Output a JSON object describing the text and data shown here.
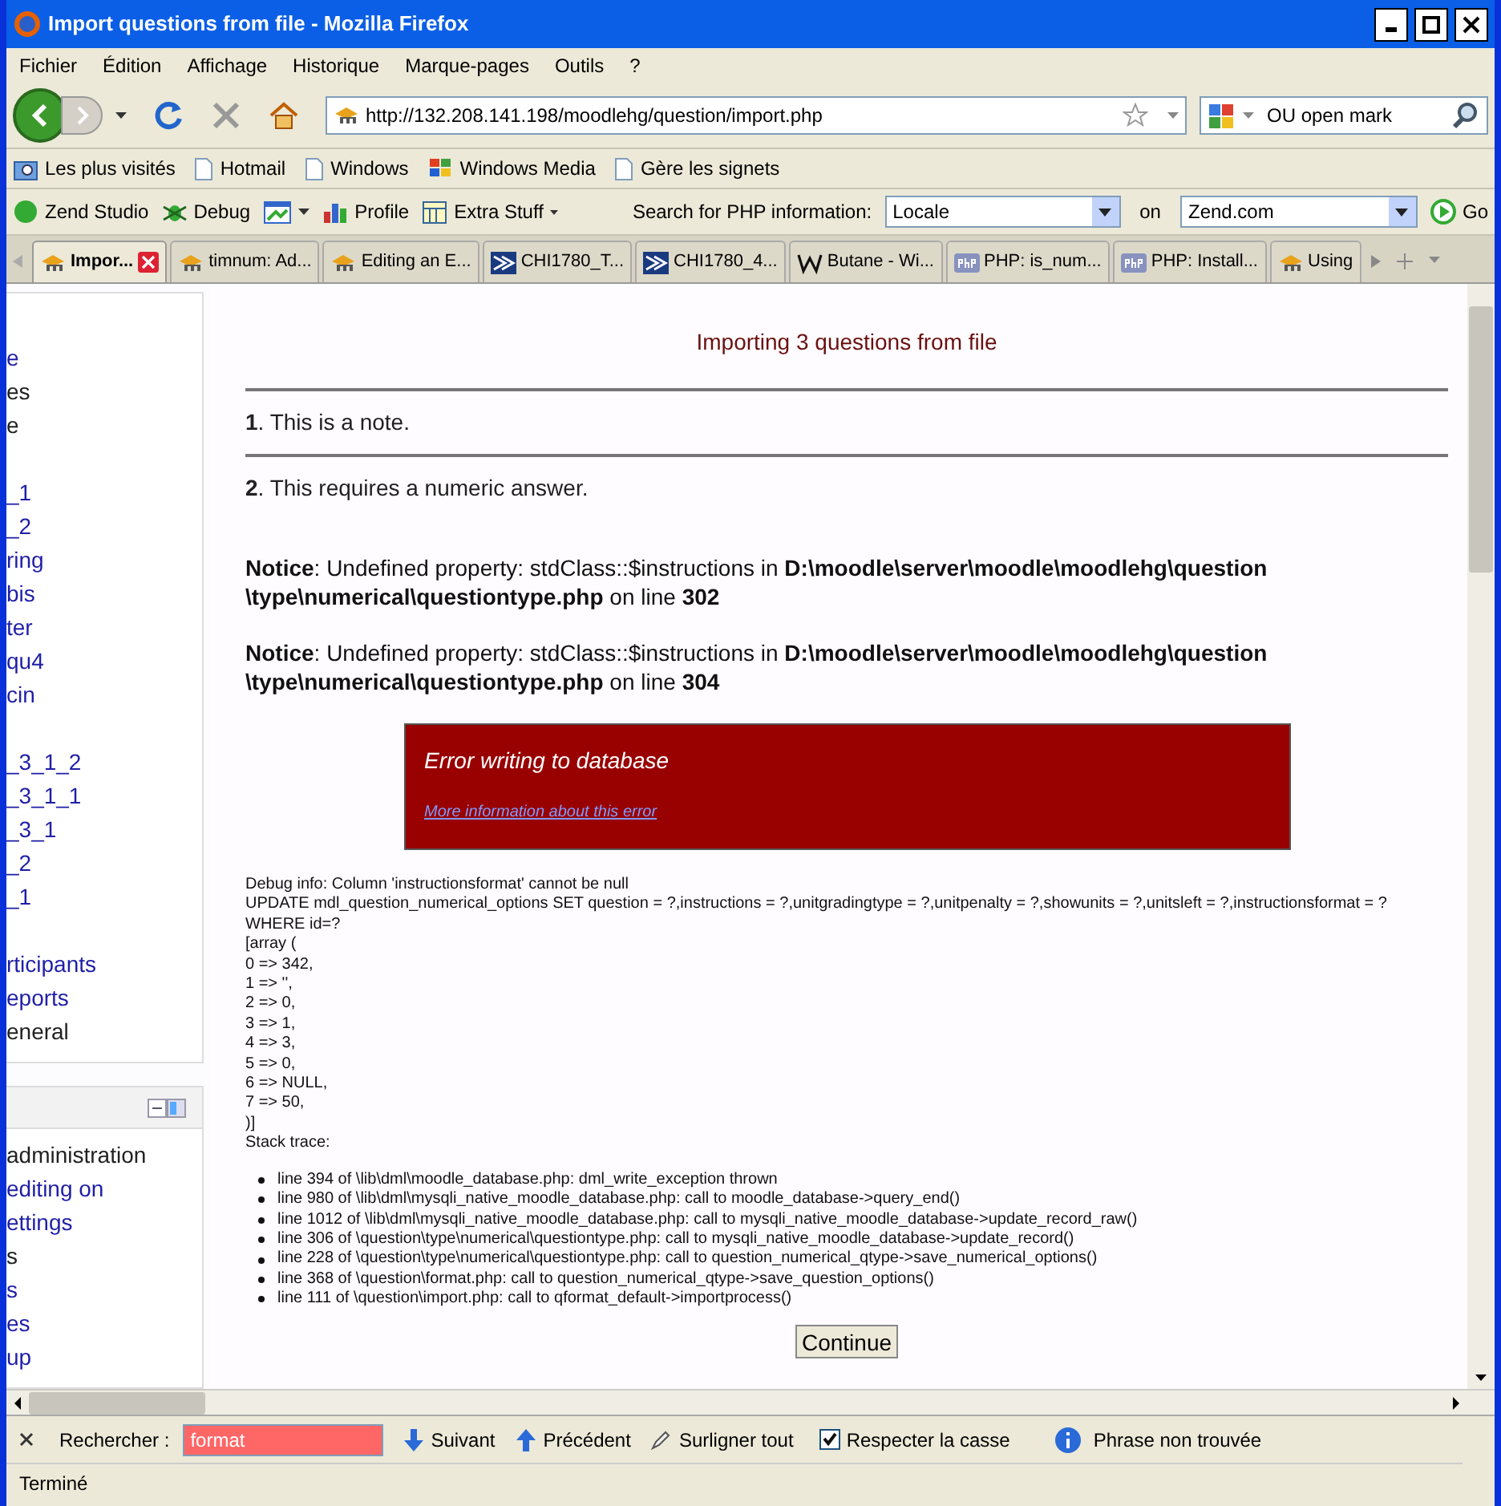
{
  "window": {
    "title": "Import questions from file - Mozilla Firefox"
  },
  "menu": [
    "Fichier",
    "Édition",
    "Affichage",
    "Historique",
    "Marque-pages",
    "Outils",
    "?"
  ],
  "nav": {
    "url": "http://132.208.141.198/moodlehg/question/import.php",
    "search": "OU open mark"
  },
  "bookmarks": [
    {
      "label": "Les plus visités",
      "kind": "folder"
    },
    {
      "label": "Hotmail",
      "kind": "page"
    },
    {
      "label": "Windows",
      "kind": "page"
    },
    {
      "label": "Windows Media",
      "kind": "windows"
    },
    {
      "label": "Gère les signets",
      "kind": "page"
    }
  ],
  "zend_toolbar": {
    "items": [
      "Zend Studio",
      "Debug",
      "Profile",
      "Extra Stuff"
    ],
    "search_label": "Search for PHP information:",
    "scope": "Locale",
    "on_label": "on",
    "site": "Zend.com",
    "go": "Go"
  },
  "tabs": [
    {
      "label": "Impor...",
      "selected": true,
      "kind": "moodle"
    },
    {
      "label": "timnum: Ad...",
      "selected": false,
      "kind": "moodle"
    },
    {
      "label": "Editing an E...",
      "selected": false,
      "kind": "moodle"
    },
    {
      "label": "CHI1780_T...",
      "selected": false,
      "kind": "arrow"
    },
    {
      "label": "CHI1780_4...",
      "selected": false,
      "kind": "arrow"
    },
    {
      "label": "Butane - Wi...",
      "selected": false,
      "kind": "wiki"
    },
    {
      "label": "PHP: is_num...",
      "selected": false,
      "kind": "php"
    },
    {
      "label": "PHP: Install...",
      "selected": false,
      "kind": "php"
    },
    {
      "label": "Using",
      "selected": false,
      "kind": "moodle"
    }
  ],
  "sidebar": {
    "blocks": [
      {
        "groups": [
          [
            {
              "text": "e",
              "link": true
            },
            {
              "text": "es",
              "link": false
            },
            {
              "text": "e",
              "link": false
            }
          ],
          [
            {
              "text": "_1",
              "link": true
            },
            {
              "text": "_2",
              "link": true
            },
            {
              "text": "ring",
              "link": true
            },
            {
              "text": "bis",
              "link": true
            },
            {
              "text": "ter",
              "link": true
            },
            {
              "text": "qu4",
              "link": true
            },
            {
              "text": "cin",
              "link": true
            }
          ],
          [
            {
              "text": "_3_1_2",
              "link": true
            },
            {
              "text": "_3_1_1",
              "link": true
            },
            {
              "text": "_3_1",
              "link": true
            },
            {
              "text": "_2",
              "link": true
            },
            {
              "text": "_1",
              "link": true
            }
          ],
          [
            {
              "text": "rticipants",
              "link": true
            },
            {
              "text": "eports",
              "link": true
            },
            {
              "text": "eneral",
              "link": false
            }
          ]
        ]
      },
      {
        "header": true,
        "groups": [
          [
            {
              "text": "administration",
              "link": false
            },
            {
              "text": "editing on",
              "link": true
            },
            {
              "text": "ettings",
              "link": true
            },
            {
              "text": "s",
              "link": false
            },
            {
              "text": "s",
              "link": true
            },
            {
              "text": "es",
              "link": true
            },
            {
              "text": "up",
              "link": true
            }
          ]
        ]
      }
    ]
  },
  "main": {
    "status": "Importing 3 questions from file",
    "questions": [
      {
        "number": "1",
        "text": ". This is a note."
      },
      {
        "number": "2",
        "text": ". This requires a numeric answer."
      }
    ],
    "notices": [
      "**Notice**: Undefined property: stdClass::$instructions in **D:\\moodle\\server\\moodle\\moodlehg\\question \\type\\numerical\\questiontype.php** on line **302**",
      "**Notice**: Undefined property: stdClass::$instructions in **D:\\moodle\\server\\moodle\\moodlehg\\question \\type\\numerical\\questiontype.php** on line **304**"
    ],
    "error": {
      "title": "Error writing to database",
      "link": "More information about this error"
    },
    "debug": [
      "Debug info: Column 'instructionsformat' cannot be null",
      "UPDATE mdl_question_numerical_options SET question = ?,instructions = ?,unitgradingtype = ?,unitpenalty = ?,showunits = ?,unitsleft = ?,instructionsformat = ? WHERE id=?",
      "[array (",
      "0 => 342,",
      "1 => '',",
      "2 => 0,",
      "3 => 1,",
      "4 => 3,",
      "5 => 0,",
      "6 => NULL,",
      "7 => 50,",
      ")]",
      "Stack trace:"
    ],
    "stack": [
      "line 394 of \\lib\\dml\\moodle_database.php: dml_write_exception thrown",
      "line 980 of \\lib\\dml\\mysqli_native_moodle_database.php: call to moodle_database->query_end()",
      "line 1012 of \\lib\\dml\\mysqli_native_moodle_database.php: call to mysqli_native_moodle_database->update_record_raw()",
      "line 306 of \\question\\type\\numerical\\questiontype.php: call to mysqli_native_moodle_database->update_record()",
      "line 228 of \\question\\type\\numerical\\questiontype.php: call to question_numerical_qtype->save_numerical_options()",
      "line 368 of \\question\\format.php: call to question_numerical_qtype->save_question_options()",
      "line 111 of \\question\\import.php: call to qformat_default->importprocess()"
    ],
    "continue": "Continue"
  },
  "find_bar": {
    "label": "Rechercher :",
    "query": "format",
    "not_found": true,
    "next": "Suivant",
    "previous": "Précédent",
    "highlight": "Surligner tout",
    "match_case": {
      "label": "Respecter la casse",
      "checked": true
    },
    "message": "Phrase non trouvée"
  },
  "status_bar": "Terminé"
}
